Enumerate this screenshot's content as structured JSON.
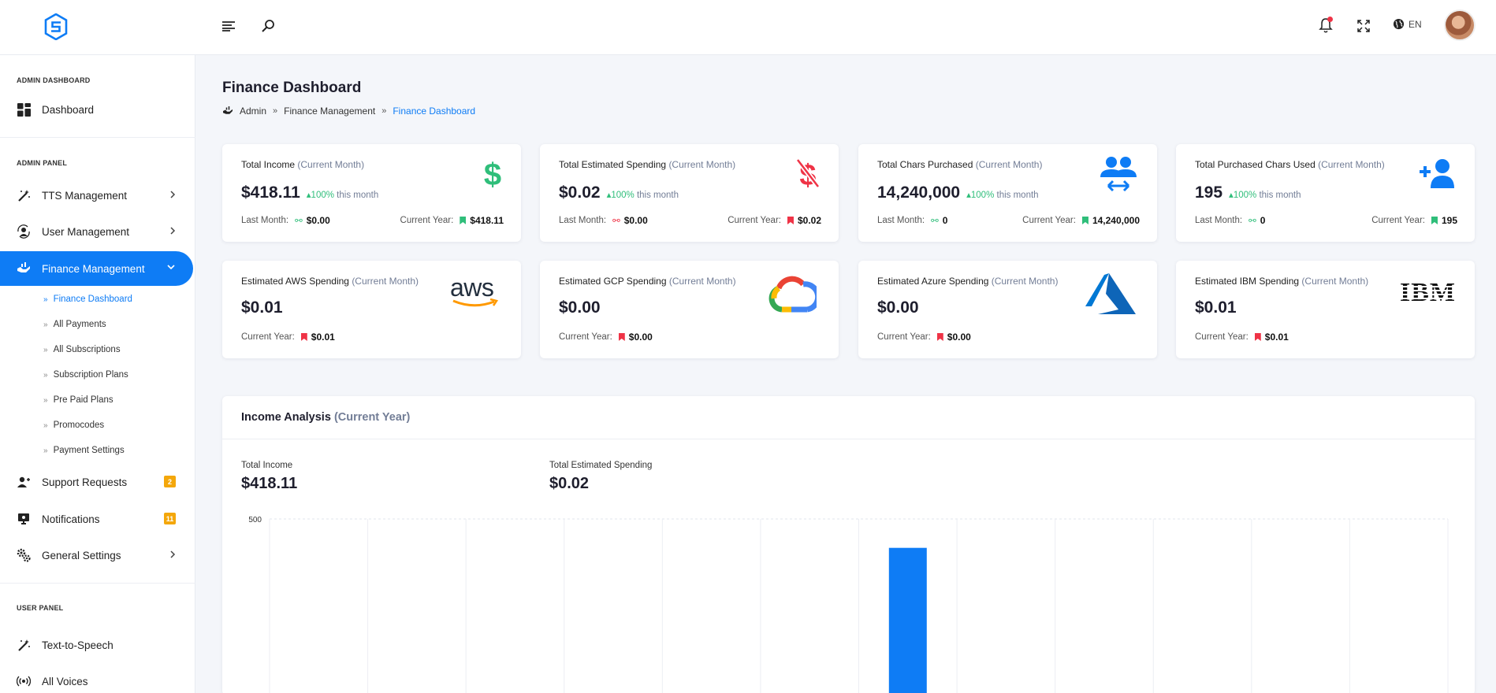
{
  "topbar": {
    "lang": "EN",
    "icons": [
      "logo-icon",
      "menu-icon",
      "search-icon",
      "bell-icon",
      "fullscreen-icon",
      "globe-icon"
    ],
    "notification_dot_color": "#ef3346"
  },
  "sidebar": {
    "admin_dashboard_title": "ADMIN DASHBOARD",
    "admin_panel_title": "ADMIN PANEL",
    "user_panel_title": "USER PANEL",
    "dashboard": "Dashboard",
    "tts_management": "TTS Management",
    "user_management": "User Management",
    "finance_management": "Finance Management",
    "finance_sub": [
      "Finance Dashboard",
      "All Payments",
      "All Subscriptions",
      "Subscription Plans",
      "Pre Paid Plans",
      "Promocodes",
      "Payment Settings"
    ],
    "support_requests": "Support Requests",
    "support_badge": "2",
    "notifications": "Notifications",
    "notifications_badge": "11",
    "general_settings": "General Settings",
    "text_to_speech": "Text-to-Speech",
    "all_voices": "All Voices"
  },
  "page": {
    "title": "Finance Dashboard",
    "breadcrumb": [
      "Admin",
      "Finance Management",
      "Finance Dashboard"
    ]
  },
  "cards_row1": [
    {
      "title": "Total Income",
      "suffix": "(Current Month)",
      "value": "$418.11",
      "change": "100%",
      "change_text": "this month",
      "last_label": "Last Month:",
      "last_value": "$0.00",
      "year_label": "Current Year:",
      "year_value": "$418.11",
      "icon": "dollar-icon"
    },
    {
      "title": "Total Estimated Spending",
      "suffix": "(Current Month)",
      "value": "$0.02",
      "change": "100%",
      "change_text": "this month",
      "last_label": "Last Month:",
      "last_value": "$0.00",
      "year_label": "Current Year:",
      "year_value": "$0.02",
      "icon": "dollar-off-icon"
    },
    {
      "title": "Total Chars Purchased",
      "suffix": "(Current Month)",
      "value": "14,240,000",
      "change": "100%",
      "change_text": "this month",
      "last_label": "Last Month:",
      "last_value": "0",
      "year_label": "Current Year:",
      "year_value": "14,240,000",
      "icon": "users-transfer-icon"
    },
    {
      "title": "Total Purchased Chars Used",
      "suffix": "(Current Month)",
      "value": "195",
      "change": "100%",
      "change_text": "this month",
      "last_label": "Last Month:",
      "last_value": "0",
      "year_label": "Current Year:",
      "year_value": "195",
      "icon": "user-plus-icon"
    }
  ],
  "cards_row2": [
    {
      "title": "Estimated AWS Spending",
      "suffix": "(Current Month)",
      "value": "$0.01",
      "year_label": "Current Year:",
      "year_value": "$0.01",
      "logo_text": "aws"
    },
    {
      "title": "Estimated GCP Spending",
      "suffix": "(Current Month)",
      "value": "$0.00",
      "year_label": "Current Year:",
      "year_value": "$0.00",
      "logo_text": ""
    },
    {
      "title": "Estimated Azure Spending",
      "suffix": "(Current Month)",
      "value": "$0.00",
      "year_label": "Current Year:",
      "year_value": "$0.00",
      "logo_text": ""
    },
    {
      "title": "Estimated IBM Spending",
      "suffix": "(Current Month)",
      "value": "$0.01",
      "year_label": "Current Year:",
      "year_value": "$0.01",
      "logo_text": "IBM"
    }
  ],
  "income_analysis": {
    "title": "Income Analysis",
    "suffix": "(Current Year)",
    "total_income_label": "Total Income",
    "total_income": "$418.11",
    "total_spending_label": "Total Estimated Spending",
    "total_spending": "$0.02"
  },
  "colors": {
    "accent": "#0e7cf5",
    "green": "#2fbe7a",
    "red": "#ef3346",
    "badge": "#f4a70b"
  },
  "chart_data": {
    "type": "bar",
    "y_tick_labels": [
      "500"
    ],
    "ylim": [
      0,
      500
    ],
    "categories": [
      "",
      "",
      "",
      "",
      "",
      "",
      "",
      "",
      "",
      "",
      "",
      ""
    ],
    "series": [
      {
        "values": [
          0,
          0,
          0,
          0,
          0,
          0,
          418.11,
          0,
          0,
          0,
          0,
          0
        ]
      }
    ],
    "bar_color": "#0e7cf5"
  }
}
